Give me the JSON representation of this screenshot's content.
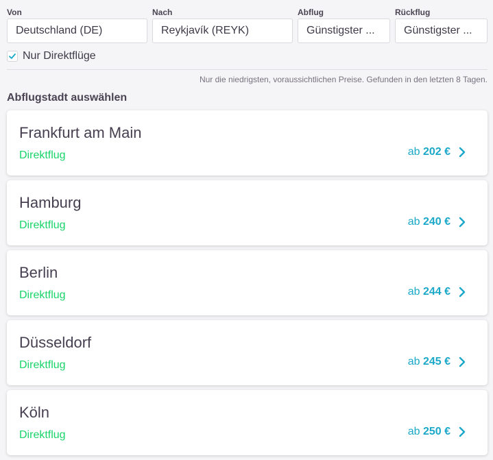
{
  "search": {
    "from": {
      "label": "Von",
      "value": "Deutschland (DE)"
    },
    "to": {
      "label": "Nach",
      "value": "Reykjavík (REYK)"
    },
    "departure": {
      "label": "Abflug",
      "value": "Günstigster ..."
    },
    "return": {
      "label": "Rückflug",
      "value": "Günstigster ..."
    },
    "direct_only": {
      "label": "Nur Direktflüge",
      "checked": true
    }
  },
  "note": "Nur die niedrigsten, voraussichtlichen Preise. Gefunden in den letzten 8 Tagen.",
  "section_title": "Abflugstadt auswählen",
  "cities": [
    {
      "name": "Frankfurt am Main",
      "type": "Direktflug",
      "price_prefix": "ab",
      "price": "202 €"
    },
    {
      "name": "Hamburg",
      "type": "Direktflug",
      "price_prefix": "ab",
      "price": "240 €"
    },
    {
      "name": "Berlin",
      "type": "Direktflug",
      "price_prefix": "ab",
      "price": "244 €"
    },
    {
      "name": "Düsseldorf",
      "type": "Direktflug",
      "price_prefix": "ab",
      "price": "245 €"
    },
    {
      "name": "Köln",
      "type": "Direktflug",
      "price_prefix": "ab",
      "price": "250 €"
    }
  ],
  "colors": {
    "direct": "#19d46a",
    "price": "#1aa8c9",
    "check": "#1aa8c9"
  },
  "icons": {
    "checkmark": "check-icon",
    "card_arrow": "chevron-right-icon"
  }
}
